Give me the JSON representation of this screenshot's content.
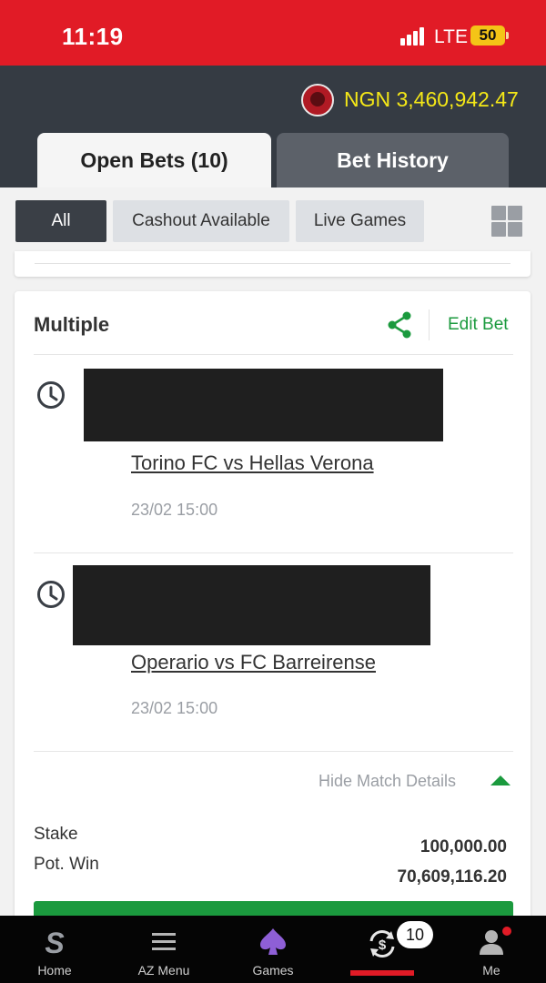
{
  "status_bar": {
    "time": "11:19",
    "network": "LTE",
    "battery": "50"
  },
  "header": {
    "balance": "NGN 3,460,942.47",
    "tabs": [
      {
        "label": "Open Bets (10)",
        "active": true
      },
      {
        "label": "Bet History",
        "active": false
      }
    ]
  },
  "filters": [
    {
      "label": "All",
      "selected": true
    },
    {
      "label": "Cashout Available",
      "selected": false
    },
    {
      "label": "Live Games",
      "selected": false
    }
  ],
  "bet_card": {
    "title": "Multiple",
    "edit_label": "Edit Bet",
    "selections": [
      {
        "match": "Torino FC vs Hellas Verona",
        "date": "23/02 15:00"
      },
      {
        "match": "Operario vs FC Barreirense",
        "date": "23/02 15:00"
      }
    ],
    "hide_details_label": "Hide Match Details",
    "stake_label": "Stake",
    "potwin_label": "Pot. Win",
    "stake_value": "100,000.00",
    "potwin_value": "70,609,116.20"
  },
  "bottom_nav": {
    "items": [
      {
        "label": "Home",
        "icon": "sportybet-s-icon"
      },
      {
        "label": "AZ Menu",
        "icon": "hamburger-menu-icon"
      },
      {
        "label": "Games",
        "icon": "spade-icon"
      },
      {
        "label": "",
        "icon": "open-bets-icon"
      },
      {
        "label": "Me",
        "icon": "user-icon"
      }
    ],
    "open_bets_count": "10"
  },
  "colors": {
    "brand_red": "#e11b26",
    "header_dark": "#353b43",
    "accent_green": "#1b9a3e",
    "balance_yellow": "#f5e817"
  }
}
